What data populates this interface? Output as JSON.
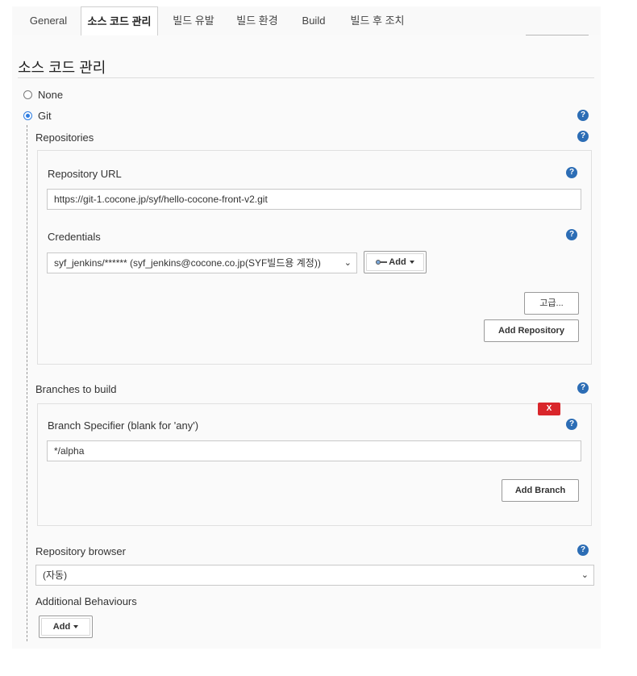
{
  "tabs": [
    {
      "label": "General"
    },
    {
      "label": "소스 코드 관리"
    },
    {
      "label": "빌드 유발"
    },
    {
      "label": "빌드 환경"
    },
    {
      "label": "Build"
    },
    {
      "label": "빌드 후 조치"
    }
  ],
  "section_title": "소스 코드 관리",
  "scm_options": {
    "none_label": "None",
    "git_label": "Git",
    "selected": "Git"
  },
  "help_glyph": "?",
  "repositories": {
    "label": "Repositories",
    "url_label": "Repository URL",
    "url_value": "https://git-1.cocone.jp/syf/hello-cocone-front-v2.git",
    "credentials_label": "Credentials",
    "credentials_value": "syf_jenkins/****** (syf_jenkins@cocone.co.jp(SYF빌드용 계정))",
    "add_label": "Add",
    "advanced_label": "고급...",
    "add_repository_label": "Add Repository"
  },
  "branches": {
    "label": "Branches to build",
    "delete_label": "X",
    "specifier_label": "Branch Specifier (blank for 'any')",
    "specifier_value": "*/alpha",
    "add_branch_label": "Add Branch"
  },
  "repository_browser": {
    "label": "Repository browser",
    "value": "(자동)"
  },
  "additional_behaviours": {
    "label": "Additional Behaviours",
    "add_label": "Add"
  },
  "icons": {
    "help": "help-icon",
    "radio": "radio-icon",
    "key": "key-icon",
    "caret": "caret-down-icon",
    "chevron": "chevron-down-icon"
  },
  "colors": {
    "help_blue": "#2c6db5",
    "delete_red": "#d9262b",
    "radio_blue": "#2f7de1"
  }
}
